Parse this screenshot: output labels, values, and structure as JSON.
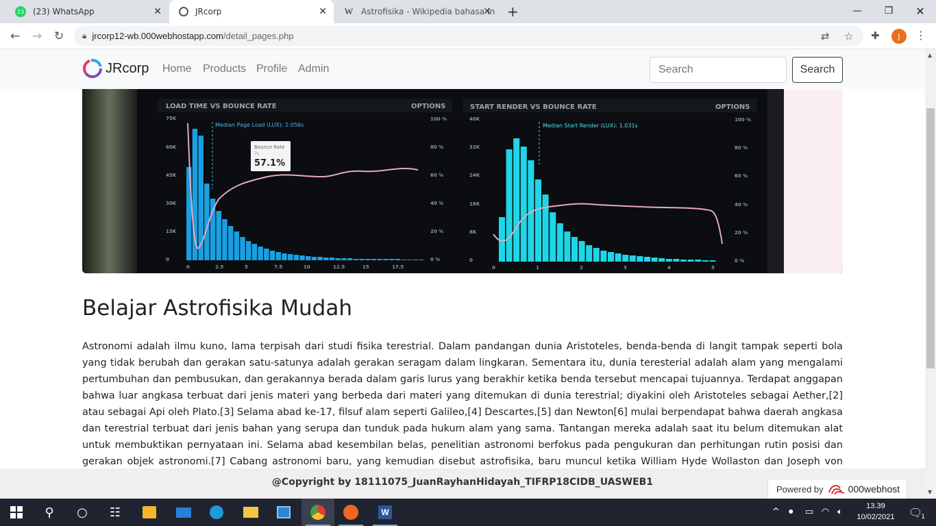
{
  "browser": {
    "tabs": [
      {
        "title": "(23) WhatsApp",
        "badge": "23"
      },
      {
        "title": "JRcorp"
      },
      {
        "title": "Astrofisika - Wikipedia bahasa In"
      }
    ],
    "new_tab": "+",
    "url_host": "jrcorp12-wb.000webhostapp.com",
    "url_path": "/detail_pages.php",
    "profile_initial": "J"
  },
  "site": {
    "brand": "JRcorp",
    "nav": [
      "Home",
      "Products",
      "Profile",
      "Admin"
    ],
    "search_placeholder": "Search",
    "search_button": "Search"
  },
  "hero": {
    "left_title": "LOAD TIME VS BOUNCE RATE",
    "right_title": "START RENDER VS BOUNCE RATE",
    "options": "OPTIONS",
    "left_median": "Median Page Load (LUX): 2.056s",
    "right_median": "Median Start Render (LUX): 1.031s",
    "tooltip_label": "Bounce Rate",
    "tooltip_sub": "7s",
    "tooltip_value": "57.1%",
    "left_y": [
      "75K",
      "60K",
      "45K",
      "30K",
      "15K",
      "0"
    ],
    "left_x": [
      "0",
      "2.5",
      "5",
      "7.5",
      "10",
      "12.5",
      "15",
      "17.5"
    ],
    "right_y": [
      "40K",
      "32K",
      "24K",
      "16K",
      "8K",
      "0"
    ],
    "right_x": [
      "0",
      "1",
      "2",
      "3",
      "4",
      "5"
    ],
    "pct": [
      "100 %",
      "80 %",
      "60 %",
      "40 %",
      "20 %",
      "0 %"
    ]
  },
  "article": {
    "title": "Belajar Astrofisika Mudah",
    "body": "Astronomi adalah ilmu kuno, lama terpisah dari studi fisika terestrial. Dalam pandangan dunia Aristoteles, benda-benda di langit tampak seperti bola yang tidak berubah dan gerakan satu-satunya adalah gerakan seragam dalam lingkaran. Sementara itu, dunia teresterial adalah alam yang mengalami pertumbuhan dan pembusukan, dan gerakannya berada dalam garis lurus yang berakhir ketika benda tersebut mencapai tujuannya. Terdapat anggapan bahwa luar angkasa terbuat dari jenis materi yang berbeda dari materi yang ditemukan di dunia terestrial; diyakini oleh Aristoteles sebagai Aether,[2] atau sebagai Api oleh Plato.[3] Selama abad ke-17, filsuf alam seperti Galileo,[4] Descartes,[5] dan Newton[6] mulai berpendapat bahwa daerah angkasa dan terestrial terbuat dari jenis bahan yang serupa dan tunduk pada hukum alam yang sama. Tantangan mereka adalah saat itu belum ditemukan alat untuk membuktikan pernyataan ini. Selama abad kesembilan belas, penelitian astronomi berfokus pada pengukuran dan perhitungan rutin posisi dan gerakan objek astronomi.[7] Cabang astronomi baru, yang kemudian disebut astrofisika, baru muncul ketika William Hyde Wollaston dan Joseph von Fraunhofer"
  },
  "footer": {
    "copyright": "@Copyright by 18111075_JuanRayhanHidayah_TIFRP18CIDB_UASWEB1",
    "powered_by": "Powered by",
    "host_brand": "000webhost"
  },
  "taskbar": {
    "time": "13.39",
    "date": "10/02/2021",
    "notifications": "1"
  },
  "colors": {
    "bar_left": "#1a9fe0",
    "bar_right": "#1ed6e8",
    "curve": "#e7a9c0"
  }
}
